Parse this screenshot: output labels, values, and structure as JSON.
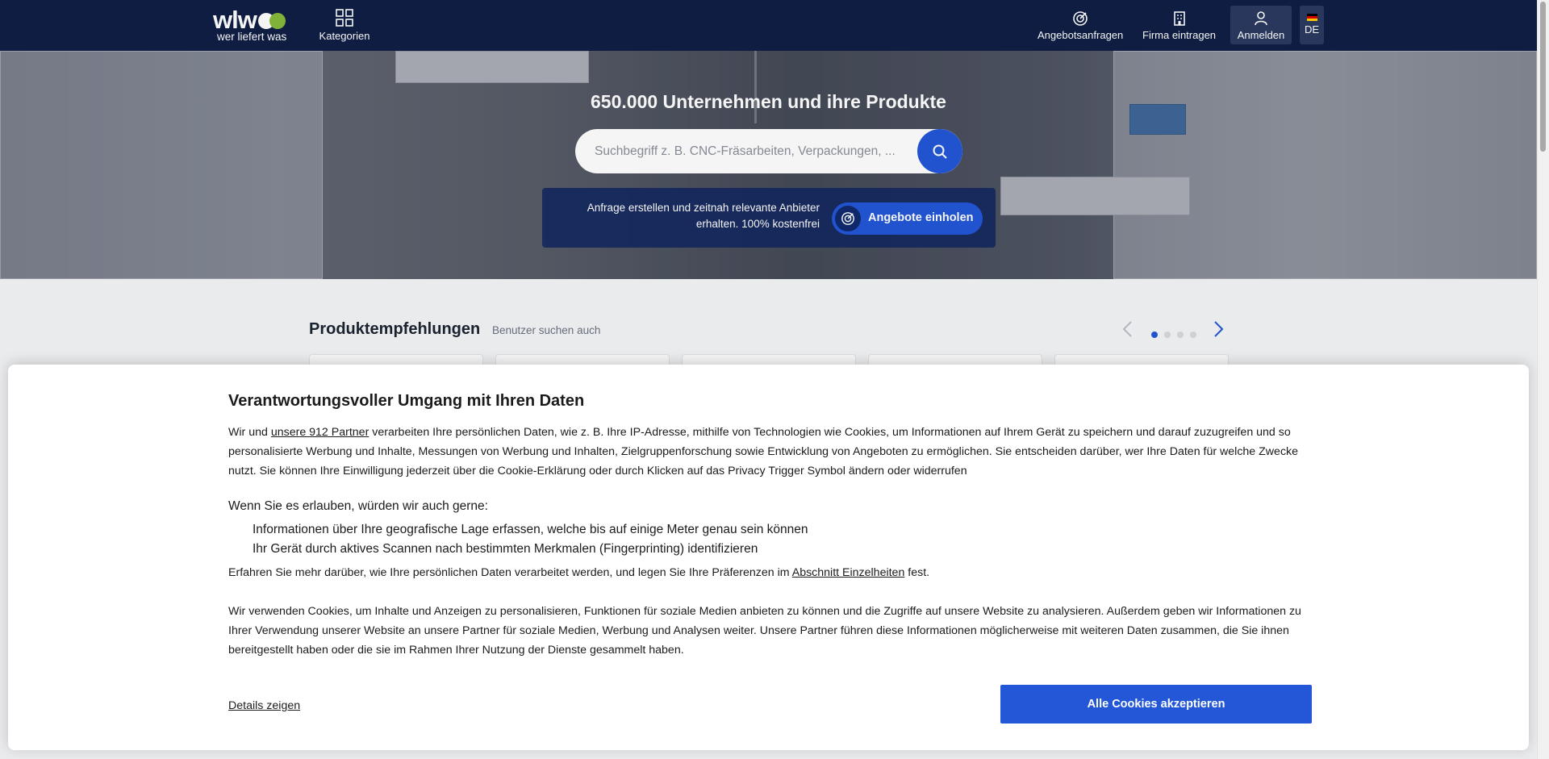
{
  "header": {
    "logo_text": "wlw",
    "logo_subtitle": "wer liefert was",
    "categories_label": "Kategorien",
    "rfq_label": "Angebotsanfragen",
    "register_company_label": "Firma eintragen",
    "login_label": "Anmelden",
    "language_label": "DE",
    "icons": [
      "grid-icon",
      "target-icon",
      "building-icon",
      "user-icon",
      "germany-flag-icon"
    ]
  },
  "hero": {
    "title": "650.000 Unternehmen und ihre Produkte",
    "search_placeholder": "Suchbegriff z. B. CNC-Fräsarbeiten, Verpackungen, ...",
    "rfq_text_line1": "Anfrage erstellen und zeitnah relevante Anbieter",
    "rfq_text_line2": "erhalten. 100% kostenfrei",
    "rfq_button": "Angebote einholen"
  },
  "recommendations": {
    "title": "Produktempfehlungen",
    "subtitle": "Benutzer suchen auch",
    "page_count": 4,
    "current_page": 1
  },
  "cookie_dialog": {
    "title": "Verantwortungsvoller Umgang mit Ihren Daten",
    "p1_before": "Wir und ",
    "p1_link": "unsere 912 Partner",
    "p1_after": " verarbeiten Ihre persönlichen Daten, wie z. B. Ihre IP-Adresse, mithilfe von Technologien wie Cookies, um Informationen auf Ihrem Gerät zu speichern und darauf zuzugreifen und so personalisierte Werbung und Inhalte, Messungen von Werbung und Inhalten, Zielgruppenforschung sowie Entwicklung von Angeboten zu ermöglichen. Sie entscheiden darüber, wer Ihre Daten für welche Zwecke nutzt. Sie können Ihre Einwilligung jederzeit über die Cookie-Erklärung oder durch Klicken auf das Privacy Trigger Symbol ändern oder widerrufen",
    "wenn": "Wenn Sie es erlauben, würden wir auch gerne:",
    "items": [
      "Informationen über Ihre geografische Lage erfassen, welche bis auf einige Meter genau sein können",
      "Ihr Gerät durch aktives Scannen nach bestimmten Merkmalen (Fingerprinting) identifizieren"
    ],
    "p2_before": "Erfahren Sie mehr darüber, wie Ihre persönlichen Daten verarbeitet werden, und legen Sie Ihre Präferenzen im ",
    "p2_link": "Abschnitt Einzelheiten",
    "p2_after": " fest.",
    "p3": "Wir verwenden Cookies, um Inhalte und Anzeigen zu personalisieren, Funktionen für soziale Medien anbieten zu können und die Zugriffe auf unsere Website zu analysieren. Außerdem geben wir Informationen zu Ihrer Verwendung unserer Website an unsere Partner für soziale Medien, Werbung und Analysen weiter. Unsere Partner führen diese Informationen möglicherweise mit weiteren Daten zusammen, die Sie ihnen bereitgestellt haben oder die sie im Rahmen Ihrer Nutzung der Dienste gesammelt haben.",
    "details_link": "Details zeigen",
    "accept_button": "Alle Cookies akzeptieren"
  },
  "colors": {
    "header_bg": "#0f1f44",
    "accent": "#2357d8",
    "logo_green": "#86b93c"
  }
}
